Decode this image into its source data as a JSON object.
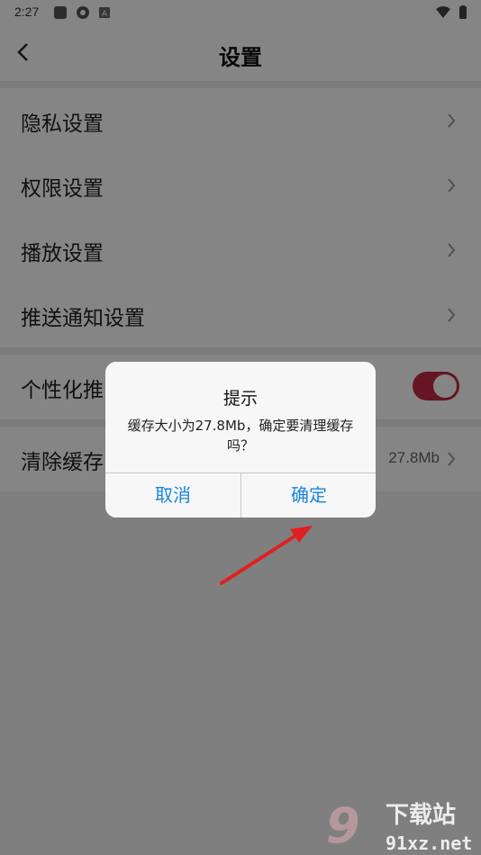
{
  "status_bar": {
    "time": "2:27"
  },
  "header": {
    "title": "设置"
  },
  "settings": {
    "privacy": "隐私设置",
    "permissions": "权限设置",
    "playback": "播放设置",
    "push": "推送通知设置",
    "personalized_visible": "个性化推",
    "personalized_toggle_on": true,
    "clear_cache_visible": "清除缓存",
    "cache_size": "27.8Mb"
  },
  "dialog": {
    "title": "提示",
    "message": "缓存大小为27.8Mb，确定要清理缓存吗？",
    "cancel_label": "取消",
    "confirm_label": "确定"
  },
  "watermark": {
    "brand": "下载站",
    "domain": "91xz.net"
  },
  "colors": {
    "accent": "#1a86e0",
    "toggle_on": "#c42a43",
    "arrow": "#e02020"
  }
}
